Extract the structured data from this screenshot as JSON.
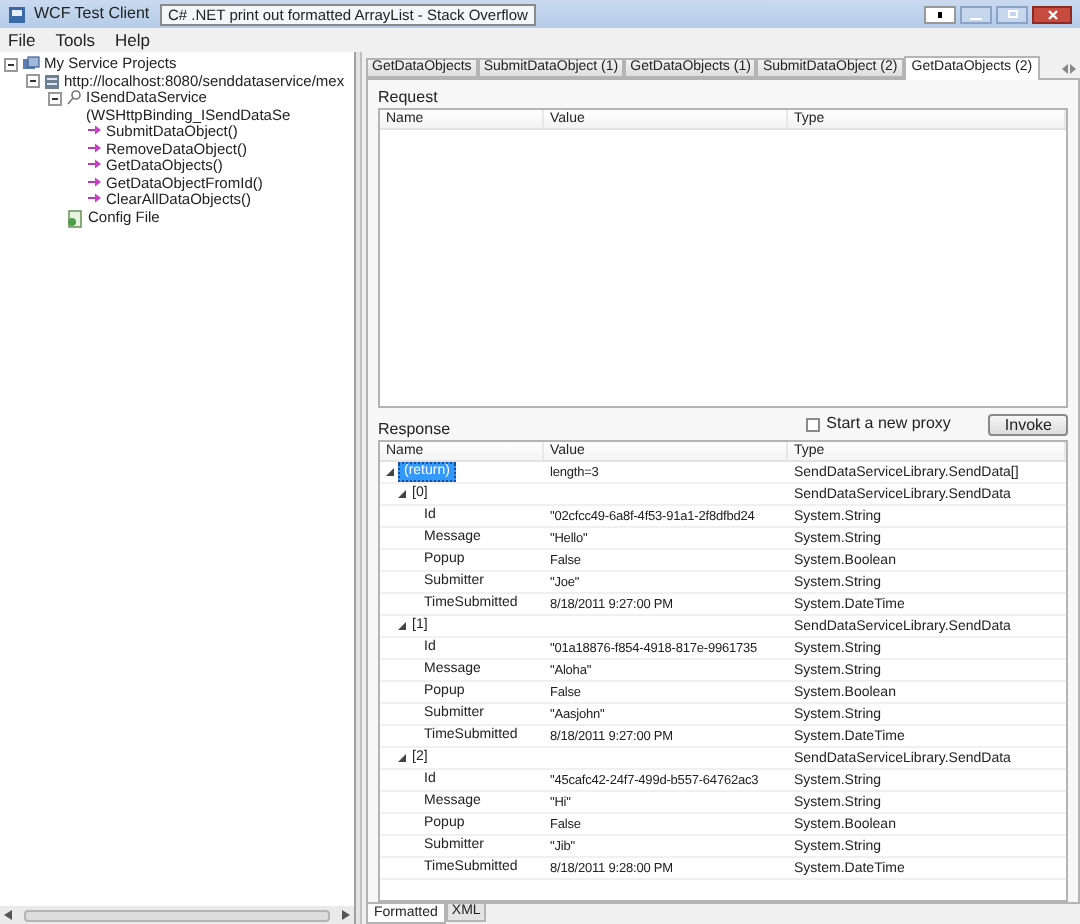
{
  "window": {
    "title": "WCF Test Client"
  },
  "tooltip": "C# .NET print out formatted ArrayList - Stack Overflow",
  "menu": [
    "File",
    "Tools",
    "Help"
  ],
  "tree": [
    {
      "label": "My Service Projects",
      "kind": "projects",
      "expanded": true,
      "children": [
        {
          "label": "http://localhost:8080/senddataservice/mex",
          "kind": "endpoint",
          "expanded": true,
          "children": [
            {
              "label": "ISendDataService (WSHttpBinding_ISendDataSe",
              "kind": "contract",
              "expanded": true,
              "children": [
                {
                  "label": "SubmitDataObject()",
                  "kind": "method"
                },
                {
                  "label": "RemoveDataObject()",
                  "kind": "method"
                },
                {
                  "label": "GetDataObjects()",
                  "kind": "method"
                },
                {
                  "label": "GetDataObjectFromId()",
                  "kind": "method"
                },
                {
                  "label": "ClearAllDataObjects()",
                  "kind": "method"
                }
              ]
            },
            {
              "label": "Config File",
              "kind": "config"
            }
          ]
        }
      ]
    }
  ],
  "tabs": [
    {
      "label": "GetDataObjects",
      "selected": false
    },
    {
      "label": "SubmitDataObject (1)",
      "selected": false
    },
    {
      "label": "GetDataObjects (1)",
      "selected": false
    },
    {
      "label": "SubmitDataObject (2)",
      "selected": false
    },
    {
      "label": "GetDataObjects (2)",
      "selected": true
    }
  ],
  "request": {
    "title": "Request",
    "columns": [
      "Name",
      "Value",
      "Type"
    ]
  },
  "response": {
    "title": "Response",
    "new_proxy": {
      "label": "Start a new proxy",
      "checked": false
    },
    "invoke": "Invoke",
    "columns": [
      "Name",
      "Value",
      "Type"
    ],
    "rows": [
      {
        "name": "(return)",
        "value": "length=3",
        "type": "SendDataServiceLibrary.SendData[]",
        "selected": true,
        "expanded": true,
        "children": [
          {
            "name": "[0]",
            "type": "SendDataServiceLibrary.SendData",
            "selected": false,
            "expanded": true,
            "children": [
              {
                "name": "Id",
                "value": "\"02cfcc49-6a8f-4f53-91a1-2f8dfbd24",
                "type": "System.String",
                "selected": false
              },
              {
                "name": "Message",
                "value": "\"Hello\"",
                "type": "System.String",
                "selected": false
              },
              {
                "name": "Popup",
                "value": "False",
                "type": "System.Boolean",
                "selected": false
              },
              {
                "name": "Submitter",
                "value": "\"Joe\"",
                "type": "System.String",
                "selected": false
              },
              {
                "name": "TimeSubmitted",
                "value": "8/18/2011 9:27:00 PM",
                "type": "System.DateTime",
                "selected": false
              }
            ]
          },
          {
            "name": "[1]",
            "type": "SendDataServiceLibrary.SendData",
            "selected": false,
            "expanded": true,
            "children": [
              {
                "name": "Id",
                "value": "\"01a18876-f854-4918-817e-9961735",
                "type": "System.String",
                "selected": false
              },
              {
                "name": "Message",
                "value": "\"Aloha\"",
                "type": "System.String",
                "selected": false
              },
              {
                "name": "Popup",
                "value": "False",
                "type": "System.Boolean",
                "selected": false
              },
              {
                "name": "Submitter",
                "value": "\"Aasjohn\"",
                "type": "System.String",
                "selected": false
              },
              {
                "name": "TimeSubmitted",
                "value": "8/18/2011 9:27:00 PM",
                "type": "System.DateTime",
                "selected": false
              }
            ]
          },
          {
            "name": "[2]",
            "type": "SendDataServiceLibrary.SendData",
            "selected": false,
            "expanded": true,
            "children": [
              {
                "name": "Id",
                "value": "\"45cafc42-24f7-499d-b557-64762ac3",
                "type": "System.String",
                "selected": false
              },
              {
                "name": "Message",
                "value": "\"Hi\"",
                "type": "System.String",
                "selected": false
              },
              {
                "name": "Popup",
                "value": "False",
                "type": "System.Boolean",
                "selected": false
              },
              {
                "name": "Submitter",
                "value": "\"Jib\"",
                "type": "System.String",
                "selected": false
              },
              {
                "name": "TimeSubmitted",
                "value": "8/18/2011 9:28:00 PM",
                "type": "System.DateTime",
                "selected": false
              }
            ]
          }
        ]
      }
    ]
  },
  "bottom_tabs": [
    {
      "label": "Formatted",
      "selected": true
    },
    {
      "label": "XML",
      "selected": false
    }
  ]
}
